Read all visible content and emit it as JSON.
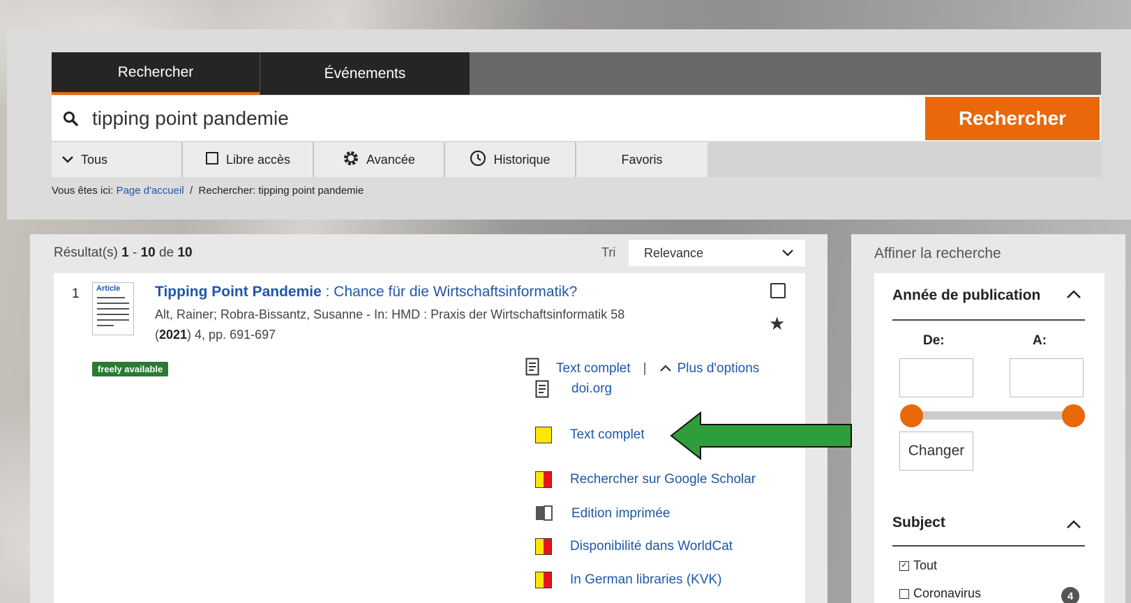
{
  "tabs": [
    {
      "label": "Rechercher",
      "active": true
    },
    {
      "label": "Événements",
      "active": false
    }
  ],
  "search": {
    "query": "tipping point pandemie",
    "button_label": "Rechercher"
  },
  "toolbar": {
    "scope_label": "Tous",
    "open_access_label": "Libre accès",
    "advanced_label": "Avancée",
    "history_label": "Historique",
    "favorites_label": "Favoris"
  },
  "breadcrumb": {
    "prefix": "Vous êtes ici:",
    "home": "Page d'accueil",
    "separator": "/",
    "current": "Rechercher: tipping point pandemie"
  },
  "results": {
    "label": "Résultat(s)",
    "from": "1",
    "dash": "-",
    "to": "10",
    "of_label": "de",
    "total": "10",
    "sort_label": "Tri",
    "sort_value": "Relevance"
  },
  "result1": {
    "number": "1",
    "type_label": "Article",
    "title_main": "Tipping Point Pandemie",
    "title_sub": " : Chance für die Wirtschaftsinformatik?",
    "authors_line1": "Alt, Rainer; Robra-Bissantz, Susanne - In: HMD : Praxis der Wirtschaftsinformatik 58",
    "year_open": "(",
    "year": "2021",
    "authors_line2_rest": ") 4, pp. 691-697",
    "badge": "freely available",
    "fulltext_label": "Text complet",
    "sep": "|",
    "more_options_label": "Plus d'options",
    "links": [
      {
        "label": "doi.org",
        "icon": "document-icon"
      },
      {
        "label": "Text complet",
        "icon": "yellow-square-icon"
      },
      {
        "label": "Rechercher sur Google Scholar",
        "icon": "yellow-red-icon"
      },
      {
        "label": "Edition imprimée",
        "icon": "book-icon"
      },
      {
        "label": "Disponibilité dans WorldCat",
        "icon": "yellow-red-icon"
      },
      {
        "label": "In German libraries (KVK)",
        "icon": "yellow-red-icon"
      }
    ]
  },
  "sidebar": {
    "title": "Affiner la recherche",
    "year_facet": {
      "title": "Année de publication",
      "from_label": "De:",
      "to_label": "A:",
      "from_value": "",
      "to_value": "",
      "change_label": "Changer"
    },
    "subject_facet": {
      "title": "Subject",
      "items": [
        {
          "label": "Tout",
          "checked": true
        },
        {
          "label": "Coronavirus",
          "checked": false,
          "count": "4"
        }
      ]
    }
  },
  "colors": {
    "accent": "#e8680a",
    "link": "#1f57a8",
    "badge": "#2a7a33",
    "arrow": "#2e9e3a"
  }
}
